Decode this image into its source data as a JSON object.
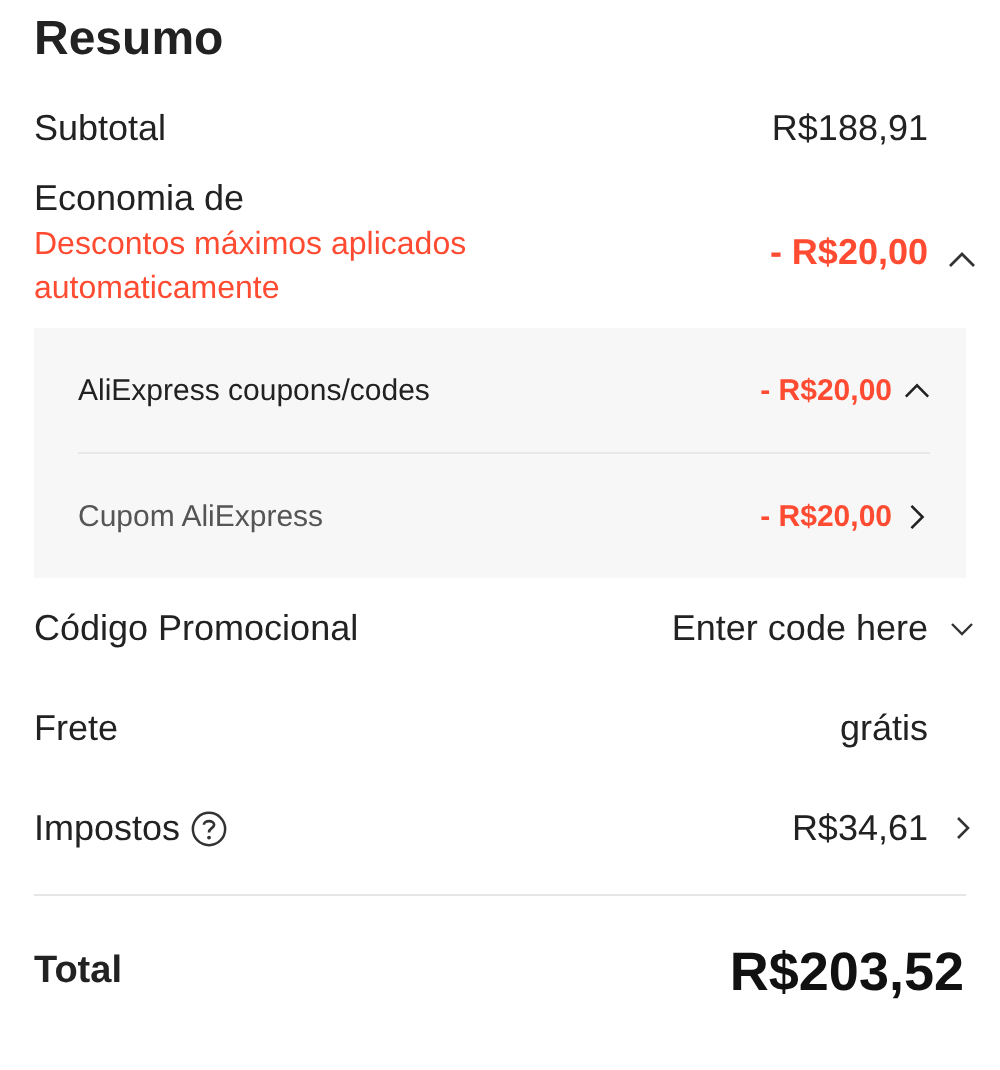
{
  "title": "Resumo",
  "subtotal": {
    "label": "Subtotal",
    "value": "R$188,91"
  },
  "savings": {
    "label": "Economia de",
    "note": "Descontos máximos aplicados automaticamente",
    "value": "- R$20,00",
    "expanded": true,
    "items": [
      {
        "kind": "toggle",
        "label": "AliExpress coupons/codes",
        "value": "- R$20,00",
        "expanded": true
      },
      {
        "kind": "link",
        "label": "Cupom AliExpress",
        "value": "- R$20,00"
      }
    ]
  },
  "promo": {
    "label": "Código Promocional",
    "placeholder": "Enter code here",
    "expanded": false
  },
  "shipping": {
    "label": "Frete",
    "value": "grátis"
  },
  "taxes": {
    "label": "Impostos",
    "value": "R$34,61"
  },
  "total": {
    "label": "Total",
    "value": "R$203,52"
  }
}
